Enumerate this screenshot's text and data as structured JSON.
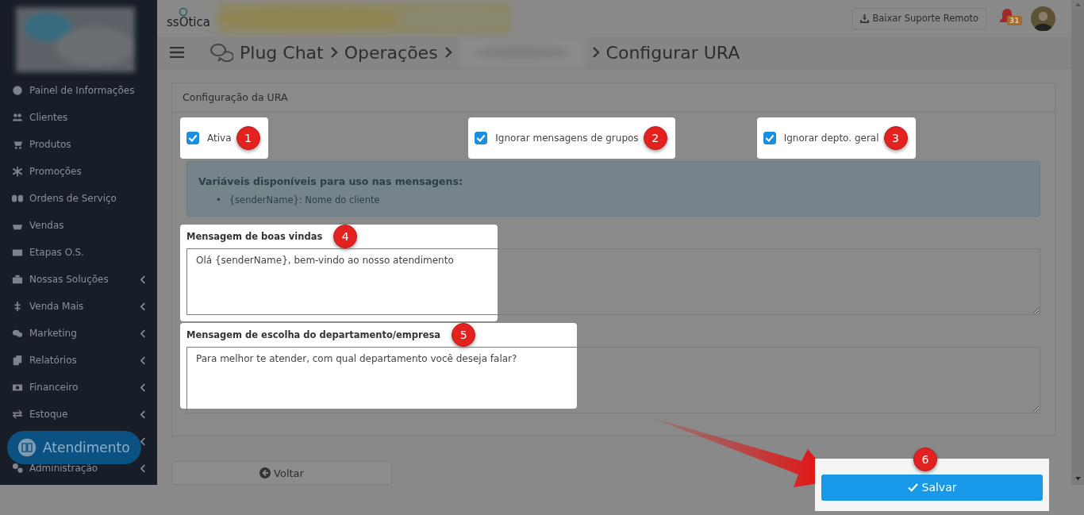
{
  "sidebar": {
    "items": [
      {
        "label": "Painel de Informações",
        "has_submenu": false
      },
      {
        "label": "Clientes",
        "has_submenu": false
      },
      {
        "label": "Produtos",
        "has_submenu": false
      },
      {
        "label": "Promoções",
        "has_submenu": false
      },
      {
        "label": "Ordens de Serviço",
        "has_submenu": false
      },
      {
        "label": "Vendas",
        "has_submenu": false
      },
      {
        "label": "Etapas O.S.",
        "has_submenu": false
      },
      {
        "label": "Nossas Soluções",
        "has_submenu": true
      },
      {
        "label": "Venda Mais",
        "has_submenu": true
      },
      {
        "label": "Marketing",
        "has_submenu": true
      },
      {
        "label": "Relatórios",
        "has_submenu": true
      },
      {
        "label": "Financeiro",
        "has_submenu": true
      },
      {
        "label": "Estoque",
        "has_submenu": true
      },
      {
        "has_submenu": true
      },
      {
        "label": "Administração",
        "has_submenu": true
      }
    ],
    "chat_button": "Atendimento"
  },
  "header": {
    "logo": "ssOtica",
    "download_button": "Baixar Suporte Remoto",
    "notification_count": "31"
  },
  "breadcrumb": [
    "Plug Chat",
    "Operações",
    "Configurar URA"
  ],
  "card": {
    "title": "Configuração da URA",
    "checkboxes": [
      {
        "label": "Ativa",
        "checked": true,
        "step": "1"
      },
      {
        "label": "Ignorar mensagens de grupos",
        "checked": true,
        "step": "2"
      },
      {
        "label": "Ignorar depto. geral",
        "checked": true,
        "step": "3"
      }
    ],
    "info": {
      "title": "Variáveis disponíveis para uso nas mensagens:",
      "items": [
        {
          "bullet": "•",
          "text": "{senderName}: Nome do cliente"
        }
      ]
    },
    "messages": [
      {
        "label": "Mensagem de boas vindas",
        "value": "Olá {senderName}, bem-vindo ao nosso atendimento",
        "step": "4"
      },
      {
        "label": "Mensagem de escolha do departamento/empresa",
        "value": "Para melhor te atender, com qual departamento você deseja falar?",
        "step": "5"
      }
    ]
  },
  "back_button": "Voltar",
  "save": {
    "label": "Salvar",
    "step": "6"
  }
}
